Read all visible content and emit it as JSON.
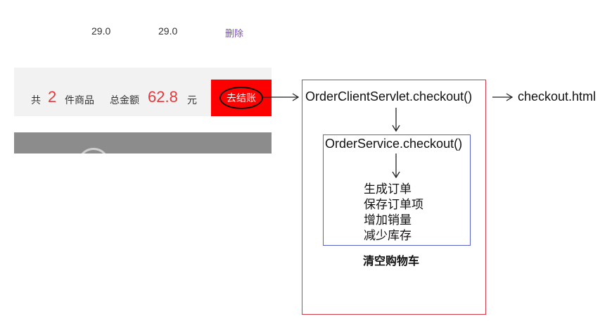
{
  "cart": {
    "row": {
      "price": "29.0",
      "subtotal": "29.0",
      "delete_label": "删除"
    },
    "summary": {
      "prefix": "共",
      "count": "2",
      "count_unit": "件商品",
      "total_label": "总金额",
      "total_value": "62.8",
      "currency": "元",
      "checkout_label": "去结账"
    }
  },
  "diagram": {
    "servlet_call": "OrderClientServlet.checkout()",
    "redirect_target": "checkout.html",
    "service_call": "OrderService.checkout()",
    "steps": [
      "生成订单",
      "保存订单项",
      "增加销量",
      "减少库存"
    ],
    "after_service": "清空购物车"
  },
  "colors": {
    "checkout_button": "#ff0000",
    "price_highlight": "#e4393c",
    "delete_link": "#7a4fb3",
    "outer_box_border": "#d03a4a",
    "inner_box_border": "#5a63c8"
  }
}
